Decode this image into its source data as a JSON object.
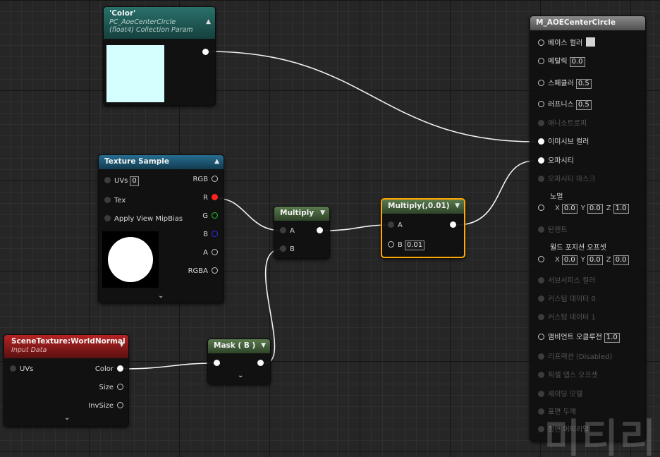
{
  "colors": {
    "param_header": "#1f5a56",
    "texture_header": "#1d5c7a",
    "scene_header": "#9a1e1e",
    "math_header": "#44603c",
    "selected_outline": "#ffa800",
    "swatch": "#d5ffff"
  },
  "param_node": {
    "title": "'Color'",
    "subtitle1": "PC_AoeCenterCircle",
    "subtitle2": "(float4) Collection Param"
  },
  "texture_node": {
    "title": "Texture Sample",
    "uvs_label": "UVs",
    "uvs_value": "0",
    "tex_label": "Tex",
    "mipbias_label": "Apply View MipBias",
    "out_rgb": "RGB",
    "out_r": "R",
    "out_g": "G",
    "out_b": "B",
    "out_a": "A",
    "out_rgba": "RGBA"
  },
  "scene_node": {
    "title": "SceneTexture:WorldNormal",
    "subtitle": "Input Data",
    "uvs_label": "UVs",
    "out_color": "Color",
    "out_size": "Size",
    "out_invsize": "InvSize"
  },
  "multiply_node": {
    "title": "Multiply",
    "in_a": "A",
    "in_b": "B"
  },
  "multiply2_node": {
    "title": "Multiply(,0.01)",
    "in_a": "A",
    "in_b": "B",
    "b_value": "0.01"
  },
  "mask_node": {
    "title": "Mask ( B )"
  },
  "material_node": {
    "title": "M_AOECenterCircle",
    "base_color": "베이스 컬러",
    "metallic": "메탈릭",
    "metallic_value": "0.0",
    "specular": "스페큘러",
    "specular_value": "0.5",
    "roughness": "러프니스",
    "roughness_value": "0.5",
    "anisotropy": "애니소트로피",
    "emissive": "이미시브 컬러",
    "opacity": "오파시티",
    "opacity_mask": "오파시티 마스크",
    "normal": "노멀",
    "normal_x": "0.0",
    "normal_y": "0.0",
    "normal_z": "1.0",
    "tangent": "탄젠트",
    "wpo": "월드 포지션 오프셋",
    "wpo_x": "0.0",
    "wpo_y": "0.0",
    "wpo_z": "0.0",
    "subsurface": "서브서피스 컬러",
    "custom0": "커스텀 데이터 0",
    "custom1": "커스텀 데이터 1",
    "ao": "앰비언트 오클루전",
    "ao_value": "1.0",
    "refraction": "리프랙션 (Disabled)",
    "pdo": "픽셀 뎁스 오프셋",
    "shading_model": "셰이딩 모델",
    "thickness": "표면 두께",
    "front_material": "정면 머티리얼",
    "axis_x": "X",
    "axis_y": "Y",
    "axis_z": "Z"
  },
  "watermark": "미티리"
}
